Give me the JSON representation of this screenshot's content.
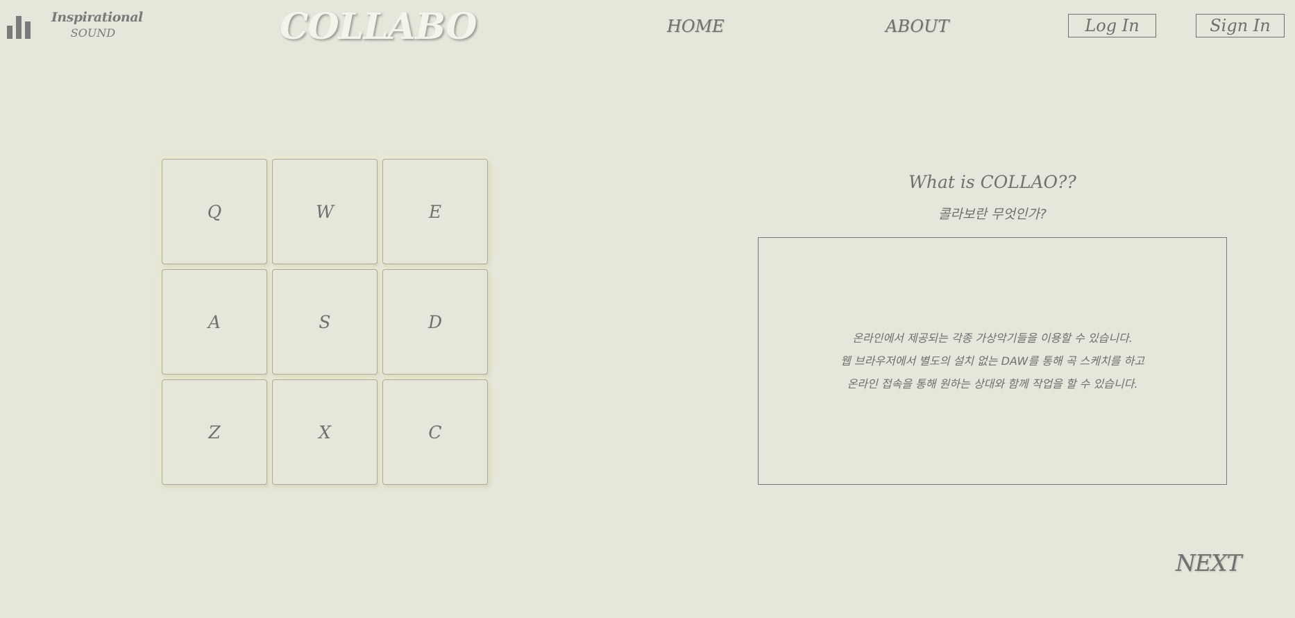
{
  "header": {
    "brand_line1": "Inspirational",
    "brand_line2": "SOUND",
    "logo_text": "COLLABO",
    "logo_icon": "bar-chart-icon",
    "nav": {
      "home": "HOME",
      "about": "ABOUT"
    },
    "login_label": "Log In",
    "signin_label": "Sign In"
  },
  "keypad": {
    "keys": [
      "Q",
      "W",
      "E",
      "A",
      "S",
      "D",
      "Z",
      "X",
      "C"
    ]
  },
  "info": {
    "title": "What is COLLAO??",
    "subtitle": "콜라보란 무엇인가?",
    "lines": [
      "온라인에서 제공되는 각종 가상악기들을 이용할 수 있습니다.",
      "웹 브라우저에서 별도의 설치 없는 DAW를 통해 곡 스케치를 하고",
      "온라인 접속을 통해 원하는 상대와 함께 작업을 할 수 있습니다."
    ]
  },
  "next_label": "NEXT",
  "colors": {
    "background": "#e6e6da",
    "text": "#6f6f6f",
    "logo": "#f4f4ec"
  }
}
